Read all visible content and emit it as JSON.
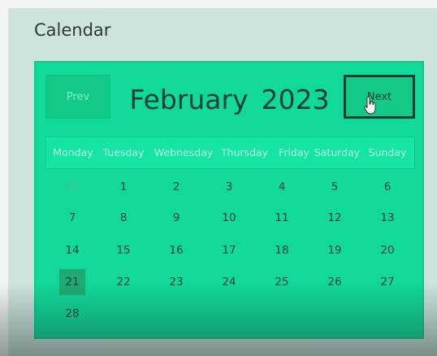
{
  "app": {
    "title": "Calendar"
  },
  "calendar": {
    "prev_label": "Prev",
    "next_label": "Next",
    "month": "February",
    "year": "2023",
    "weekdays": [
      "Monday",
      "Tuesday",
      "Webnesday",
      "Thursday",
      "Friday",
      "Saturday",
      "Sunday"
    ],
    "weeks": [
      [
        "31",
        "1",
        "2",
        "3",
        "4",
        "5",
        "6"
      ],
      [
        "7",
        "8",
        "9",
        "10",
        "11",
        "12",
        "13"
      ],
      [
        "14",
        "15",
        "16",
        "17",
        "18",
        "19",
        "20"
      ],
      [
        "21",
        "22",
        "23",
        "24",
        "25",
        "26",
        "27"
      ],
      [
        "28",
        "",
        "",
        "",
        "",
        "",
        ""
      ]
    ],
    "selected_day": "21"
  },
  "icons": {
    "cursor": "hand-pointer-icon"
  },
  "colors": {
    "panel": "#10d99a",
    "button": "#12c988",
    "selected": "#1eab73",
    "weekday_text": "#b8f6e6"
  }
}
